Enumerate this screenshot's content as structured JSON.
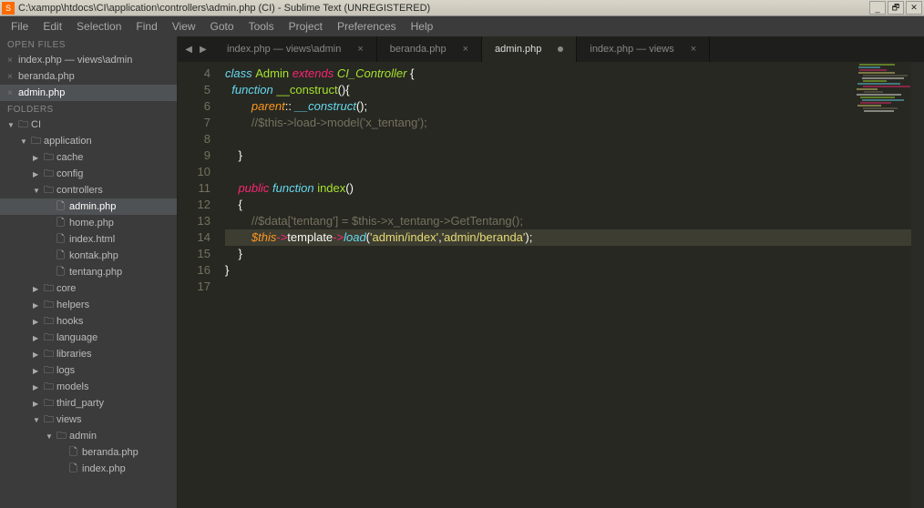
{
  "window": {
    "title": "C:\\xampp\\htdocs\\CI\\application\\controllers\\admin.php (CI) - Sublime Text (UNREGISTERED)"
  },
  "menu": [
    "File",
    "Edit",
    "Selection",
    "Find",
    "View",
    "Goto",
    "Tools",
    "Project",
    "Preferences",
    "Help"
  ],
  "sidebar": {
    "open_files_title": "OPEN FILES",
    "open_files": [
      {
        "label": "index.php — views\\admin",
        "active": false
      },
      {
        "label": "beranda.php",
        "active": false
      },
      {
        "label": "admin.php",
        "active": true
      }
    ],
    "folders_title": "FOLDERS",
    "tree": [
      {
        "indent": 0,
        "arrow": "▼",
        "icon": "🗀",
        "label": "CI"
      },
      {
        "indent": 1,
        "arrow": "▼",
        "icon": "🗀",
        "label": "application"
      },
      {
        "indent": 2,
        "arrow": "▶",
        "icon": "🗀",
        "label": "cache"
      },
      {
        "indent": 2,
        "arrow": "▶",
        "icon": "🗀",
        "label": "config"
      },
      {
        "indent": 2,
        "arrow": "▼",
        "icon": "🗀",
        "label": "controllers"
      },
      {
        "indent": 3,
        "arrow": "",
        "icon": "🗋",
        "label": "admin.php",
        "active": true
      },
      {
        "indent": 3,
        "arrow": "",
        "icon": "🗋",
        "label": "home.php"
      },
      {
        "indent": 3,
        "arrow": "",
        "icon": "🗋",
        "label": "index.html"
      },
      {
        "indent": 3,
        "arrow": "",
        "icon": "🗋",
        "label": "kontak.php"
      },
      {
        "indent": 3,
        "arrow": "",
        "icon": "🗋",
        "label": "tentang.php"
      },
      {
        "indent": 2,
        "arrow": "▶",
        "icon": "🗀",
        "label": "core"
      },
      {
        "indent": 2,
        "arrow": "▶",
        "icon": "🗀",
        "label": "helpers"
      },
      {
        "indent": 2,
        "arrow": "▶",
        "icon": "🗀",
        "label": "hooks"
      },
      {
        "indent": 2,
        "arrow": "▶",
        "icon": "🗀",
        "label": "language"
      },
      {
        "indent": 2,
        "arrow": "▶",
        "icon": "🗀",
        "label": "libraries"
      },
      {
        "indent": 2,
        "arrow": "▶",
        "icon": "🗀",
        "label": "logs"
      },
      {
        "indent": 2,
        "arrow": "▶",
        "icon": "🗀",
        "label": "models"
      },
      {
        "indent": 2,
        "arrow": "▶",
        "icon": "🗀",
        "label": "third_party"
      },
      {
        "indent": 2,
        "arrow": "▼",
        "icon": "🗀",
        "label": "views"
      },
      {
        "indent": 3,
        "arrow": "▼",
        "icon": "🗀",
        "label": "admin"
      },
      {
        "indent": 4,
        "arrow": "",
        "icon": "🗋",
        "label": "beranda.php"
      },
      {
        "indent": 4,
        "arrow": "",
        "icon": "🗋",
        "label": "index.php"
      }
    ]
  },
  "tabs": [
    {
      "label": "index.php — views\\admin",
      "active": false,
      "dirty": false
    },
    {
      "label": "beranda.php",
      "active": false,
      "dirty": false
    },
    {
      "label": "admin.php",
      "active": true,
      "dirty": true
    },
    {
      "label": "index.php — views",
      "active": false,
      "dirty": false
    }
  ],
  "code": {
    "first_line": 4,
    "highlight_line": 14,
    "lines": [
      [
        {
          "t": "class ",
          "c": "k-blue"
        },
        {
          "t": "Admin ",
          "c": "k-green"
        },
        {
          "t": "extends ",
          "c": "k-red"
        },
        {
          "t": "CI_Controller ",
          "c": "k-name"
        },
        {
          "t": "{",
          "c": "k-white"
        }
      ],
      [
        {
          "t": "  ",
          "c": ""
        },
        {
          "t": "function ",
          "c": "k-blue"
        },
        {
          "t": "__construct",
          "c": "k-green"
        },
        {
          "t": "(){",
          "c": "k-white"
        }
      ],
      [
        {
          "t": "        ",
          "c": ""
        },
        {
          "t": "parent",
          "c": "k-orange"
        },
        {
          "t": ":: ",
          "c": "k-white"
        },
        {
          "t": "__construct",
          "c": "k-blue"
        },
        {
          "t": "();",
          "c": "k-white"
        }
      ],
      [
        {
          "t": "        ",
          "c": ""
        },
        {
          "t": "//$this->load->model('x_tentang');",
          "c": "k-gray"
        }
      ],
      [
        {
          "t": " ",
          "c": ""
        }
      ],
      [
        {
          "t": "    }",
          "c": "k-white"
        }
      ],
      [
        {
          "t": " ",
          "c": ""
        }
      ],
      [
        {
          "t": "    ",
          "c": ""
        },
        {
          "t": "public ",
          "c": "k-red"
        },
        {
          "t": "function ",
          "c": "k-blue"
        },
        {
          "t": "index",
          "c": "k-green"
        },
        {
          "t": "()",
          "c": "k-white"
        }
      ],
      [
        {
          "t": "    {",
          "c": "k-white"
        }
      ],
      [
        {
          "t": "        ",
          "c": ""
        },
        {
          "t": "//$data['tentang'] = $this->x_tentang->GetTentang();",
          "c": "k-gray"
        }
      ],
      [
        {
          "t": "        ",
          "c": ""
        },
        {
          "t": "$this",
          "c": "k-orange"
        },
        {
          "t": "->",
          "c": "k-red"
        },
        {
          "t": "template",
          "c": "k-white"
        },
        {
          "t": "->",
          "c": "k-red"
        },
        {
          "t": "load",
          "c": "k-blue"
        },
        {
          "t": "(",
          "c": "k-white"
        },
        {
          "t": "'admin/index'",
          "c": "k-yellow"
        },
        {
          "t": ",",
          "c": "k-white"
        },
        {
          "t": "'admin/beranda'",
          "c": "k-yellow"
        },
        {
          "t": ");",
          "c": "k-white"
        }
      ],
      [
        {
          "t": "    }",
          "c": "k-white"
        }
      ],
      [
        {
          "t": "}",
          "c": "k-white"
        }
      ],
      [
        {
          "t": " ",
          "c": ""
        }
      ]
    ]
  }
}
